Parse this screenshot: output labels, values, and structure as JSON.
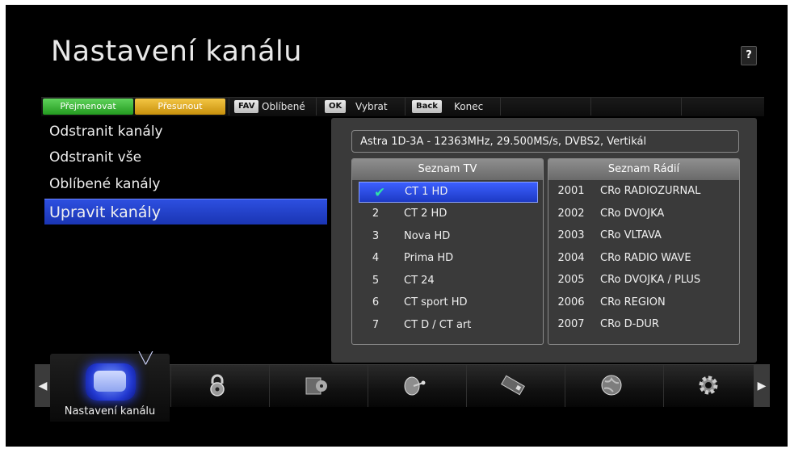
{
  "header": {
    "title": "Nastavení kanálu",
    "help_label": "?"
  },
  "keybar": {
    "red_label": "Přejmenovat",
    "yellow_label": "Přesunout",
    "fav_key": "FAV",
    "fav_label": "Oblíbené",
    "ok_key": "OK",
    "ok_label": "Vybrat",
    "back_key": "Back",
    "back_label": "Konec"
  },
  "menu": {
    "items": [
      {
        "label": "Odstranit kanály"
      },
      {
        "label": "Odstranit vše"
      },
      {
        "label": "Oblíbené kanály"
      },
      {
        "label": "Upravit kanály"
      }
    ],
    "active_index": 3
  },
  "panel": {
    "satellite_info": "Astra 1D-3A - 12363MHz, 29.500MS/s, DVBS2, Vertikál",
    "tv_list": {
      "header": "Seznam TV",
      "rows": [
        {
          "num": "",
          "name": "CT 1 HD",
          "selected": true
        },
        {
          "num": "2",
          "name": "CT 2 HD"
        },
        {
          "num": "3",
          "name": "Nova HD"
        },
        {
          "num": "4",
          "name": "Prima HD"
        },
        {
          "num": "5",
          "name": "CT 24"
        },
        {
          "num": "6",
          "name": "CT sport HD"
        },
        {
          "num": "7",
          "name": "CT D / CT art"
        }
      ]
    },
    "radio_list": {
      "header": "Seznam Rádií",
      "rows": [
        {
          "num": "2001",
          "name": "CRo RADIOZURNAL"
        },
        {
          "num": "2002",
          "name": "CRo DVOJKA"
        },
        {
          "num": "2003",
          "name": "CRo VLTAVA"
        },
        {
          "num": "2004",
          "name": "CRo RADIO WAVE"
        },
        {
          "num": "2005",
          "name": "CRo DVOJKA / PLUS"
        },
        {
          "num": "2006",
          "name": "CRo REGION"
        },
        {
          "num": "2007",
          "name": "CRo D-DUR"
        }
      ]
    }
  },
  "dock": {
    "active_label": "Nastavení kanálu",
    "icons": [
      "tv-icon",
      "lock-icon",
      "media-icon",
      "satellite-dish-icon",
      "smartcard-icon",
      "globe-icon",
      "gear-icon"
    ]
  }
}
